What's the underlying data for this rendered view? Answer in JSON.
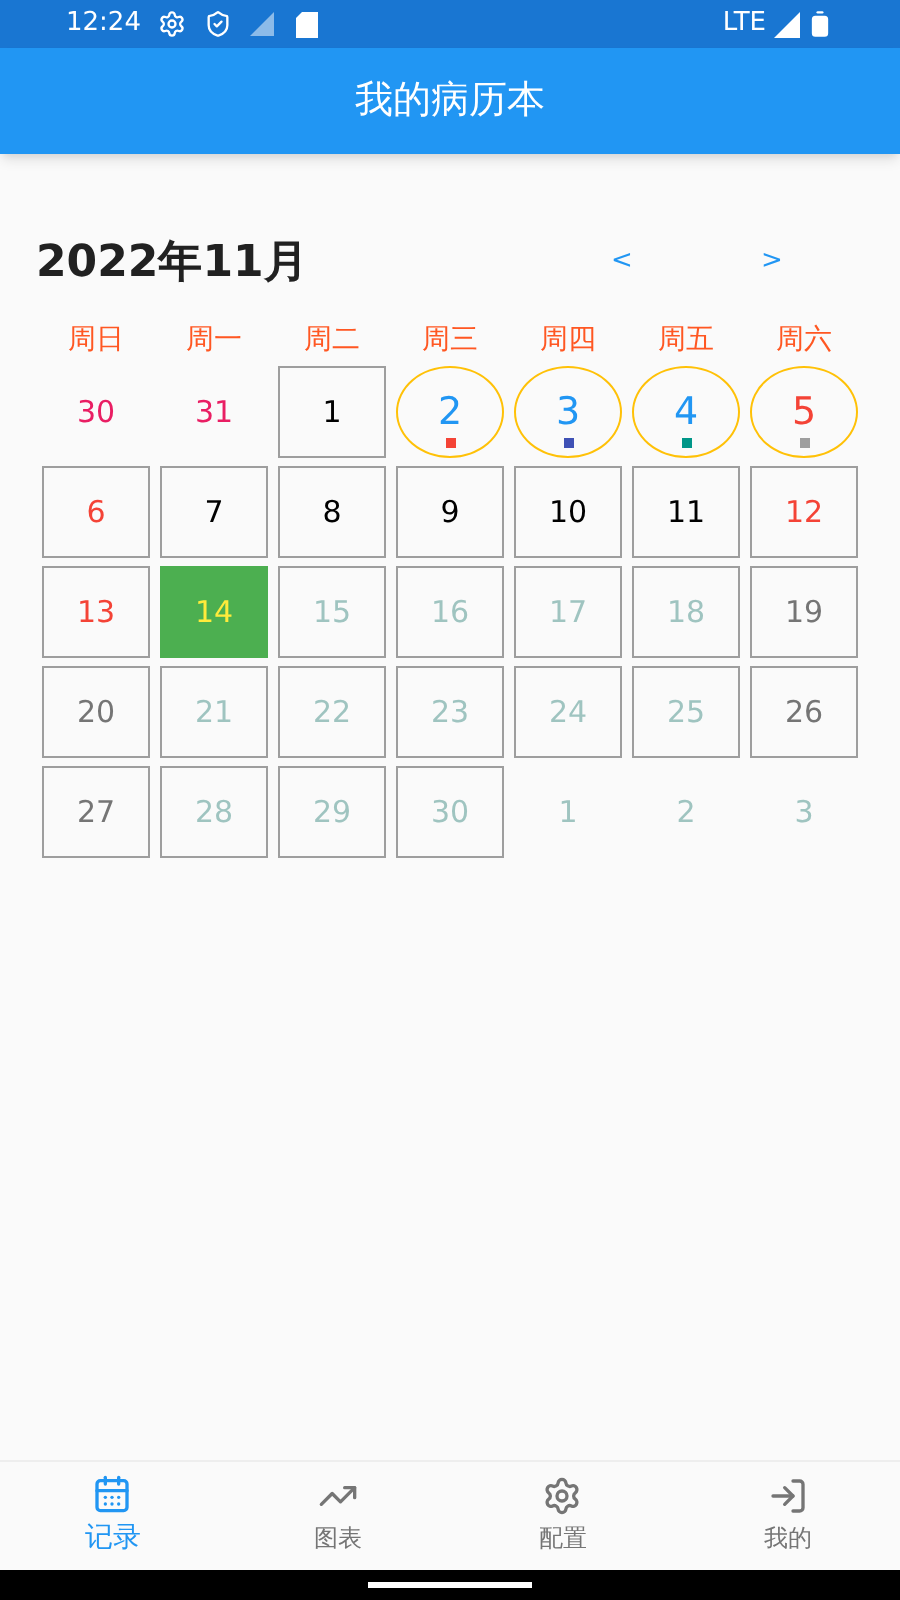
{
  "status_bar": {
    "time": "12:24",
    "network": "LTE"
  },
  "app_bar": {
    "title": "我的病历本"
  },
  "calendar": {
    "month": "2022年11月",
    "prev": "<",
    "next": ">",
    "weekdays": [
      "周日",
      "周一",
      "周二",
      "周三",
      "周四",
      "周五",
      "周六"
    ],
    "days": [
      {
        "label": "30",
        "kind": "plain",
        "color": "#e91e63"
      },
      {
        "label": "31",
        "kind": "plain",
        "color": "#e91e63"
      },
      {
        "label": "1",
        "kind": "boxed",
        "color": "#000000"
      },
      {
        "label": "2",
        "kind": "circled",
        "color": "#2196f3",
        "marker": {
          "color": "#f44336"
        }
      },
      {
        "label": "3",
        "kind": "circled",
        "color": "#2196f3",
        "marker": {
          "color": "#3f51b5"
        }
      },
      {
        "label": "4",
        "kind": "circled",
        "color": "#2196f3",
        "marker": {
          "color": "#009688"
        }
      },
      {
        "label": "5",
        "kind": "circled",
        "color": "#f44336",
        "marker": {
          "color": "#9e9e9e"
        }
      },
      {
        "label": "6",
        "kind": "boxed",
        "color": "#f44336"
      },
      {
        "label": "7",
        "kind": "boxed",
        "color": "#000000"
      },
      {
        "label": "8",
        "kind": "boxed",
        "color": "#000000"
      },
      {
        "label": "9",
        "kind": "boxed",
        "color": "#000000"
      },
      {
        "label": "10",
        "kind": "boxed",
        "color": "#000000"
      },
      {
        "label": "11",
        "kind": "boxed",
        "color": "#000000"
      },
      {
        "label": "12",
        "kind": "boxed",
        "color": "#f44336"
      },
      {
        "label": "13",
        "kind": "boxed",
        "color": "#f44336"
      },
      {
        "label": "14",
        "kind": "selected",
        "color": "#ffeb3b"
      },
      {
        "label": "15",
        "kind": "boxed",
        "color": "#9fc4c0"
      },
      {
        "label": "16",
        "kind": "boxed",
        "color": "#9fc4c0"
      },
      {
        "label": "17",
        "kind": "boxed",
        "color": "#9fc4c0"
      },
      {
        "label": "18",
        "kind": "boxed",
        "color": "#9fc4c0"
      },
      {
        "label": "19",
        "kind": "boxed",
        "color": "#757575"
      },
      {
        "label": "20",
        "kind": "boxed",
        "color": "#757575"
      },
      {
        "label": "21",
        "kind": "boxed",
        "color": "#9fc4c0"
      },
      {
        "label": "22",
        "kind": "boxed",
        "color": "#9fc4c0"
      },
      {
        "label": "23",
        "kind": "boxed",
        "color": "#9fc4c0"
      },
      {
        "label": "24",
        "kind": "boxed",
        "color": "#9fc4c0"
      },
      {
        "label": "25",
        "kind": "boxed",
        "color": "#9fc4c0"
      },
      {
        "label": "26",
        "kind": "boxed",
        "color": "#757575"
      },
      {
        "label": "27",
        "kind": "boxed",
        "color": "#757575"
      },
      {
        "label": "28",
        "kind": "boxed",
        "color": "#9fc4c0"
      },
      {
        "label": "29",
        "kind": "boxed",
        "color": "#9fc4c0"
      },
      {
        "label": "30",
        "kind": "boxed",
        "color": "#9fc4c0"
      },
      {
        "label": "1",
        "kind": "plain",
        "color": "#9fc4c0"
      },
      {
        "label": "2",
        "kind": "plain",
        "color": "#9fc4c0"
      },
      {
        "label": "3",
        "kind": "plain",
        "color": "#9fc4c0"
      }
    ]
  },
  "bottom_nav": [
    {
      "label": "记录",
      "kind": "calendar",
      "selected": true
    },
    {
      "label": "图表",
      "kind": "chart",
      "selected": false
    },
    {
      "label": "配置",
      "kind": "settings",
      "selected": false
    },
    {
      "label": "我的",
      "kind": "login",
      "selected": false
    }
  ]
}
